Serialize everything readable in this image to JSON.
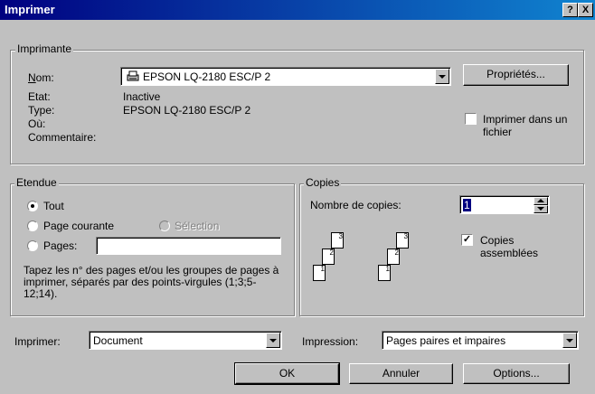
{
  "window": {
    "title": "Imprimer",
    "help_btn": "?",
    "close_btn": "X"
  },
  "printer": {
    "group_label": "Imprimante",
    "name_label": "Nom:",
    "name_value": "EPSON LQ-2180 ESC/P 2",
    "properties_button": "Propriétés...",
    "status_label": "Etat:",
    "status_value": "Inactive",
    "type_label": "Type:",
    "type_value": "EPSON LQ-2180 ESC/P 2",
    "where_label": "Où:",
    "where_value": "",
    "comment_label": "Commentaire:",
    "comment_value": "",
    "print_to_file_label": "Imprimer dans un fichier",
    "print_to_file_checked": false
  },
  "range": {
    "group_label": "Etendue",
    "all_label": "Tout",
    "current_label": "Page courante",
    "selection_label": "Sélection",
    "pages_label": "Pages:",
    "pages_value": "",
    "help_text": "Tapez les n° des pages et/ou les groupes de pages à imprimer, séparés par des points-virgules (1;3;5-12;14).",
    "selected": "all"
  },
  "copies": {
    "group_label": "Copies",
    "count_label": "Nombre de copies:",
    "count_value": "1",
    "collate_label": "Copies assemblées",
    "collate_checked": true,
    "page_numbers": [
      "1",
      "2",
      "3"
    ]
  },
  "bottom": {
    "print_what_label": "Imprimer:",
    "print_what_value": "Document",
    "print_label": "Impression:",
    "print_value": "Pages paires et impaires",
    "ok_button": "OK",
    "cancel_button": "Annuler",
    "options_button": "Options..."
  },
  "icons": {
    "printer": "printer-icon"
  }
}
